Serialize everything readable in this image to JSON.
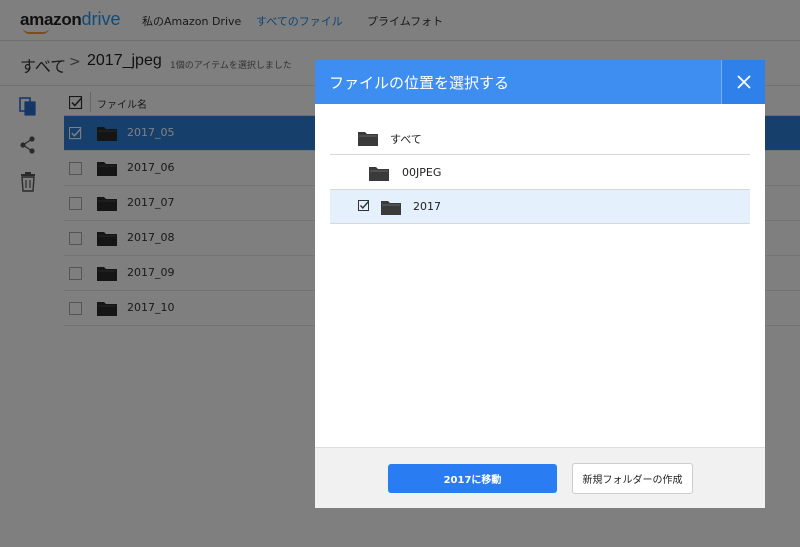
{
  "header": {
    "logo_text_a": "amazon",
    "logo_text_b": "drive",
    "nav": [
      {
        "label": "私のAmazon Drive"
      },
      {
        "label": "すべてのファイル",
        "active": true
      },
      {
        "label": "プライムフォト"
      }
    ]
  },
  "breadcrumb": {
    "root": "すべて",
    "separator": ">",
    "current": "2017_jpeg",
    "selection_count": "1個のアイテムを選択しました"
  },
  "list": {
    "column_name": "ファイル名",
    "rows": [
      {
        "name": "2017_05",
        "selected": true
      },
      {
        "name": "2017_06",
        "selected": false
      },
      {
        "name": "2017_07",
        "selected": false
      },
      {
        "name": "2017_08",
        "selected": false
      },
      {
        "name": "2017_09",
        "selected": false
      },
      {
        "name": "2017_10",
        "selected": false
      }
    ]
  },
  "modal": {
    "title": "ファイルの位置を選択する",
    "close_label": "×",
    "tree": [
      {
        "name": "すべて",
        "level": 0,
        "selected": false
      },
      {
        "name": "00JPEG",
        "level": 1,
        "selected": false
      },
      {
        "name": "2017",
        "level": 1,
        "selected": true
      }
    ],
    "primary_button": "2017に移動",
    "secondary_button": "新規フォルダーの作成"
  },
  "colors": {
    "accent": "#3d8ef0",
    "selected_row": "#2e7fd6",
    "primary_button": "#2a7cf2",
    "nav_active": "#1e88e5"
  }
}
